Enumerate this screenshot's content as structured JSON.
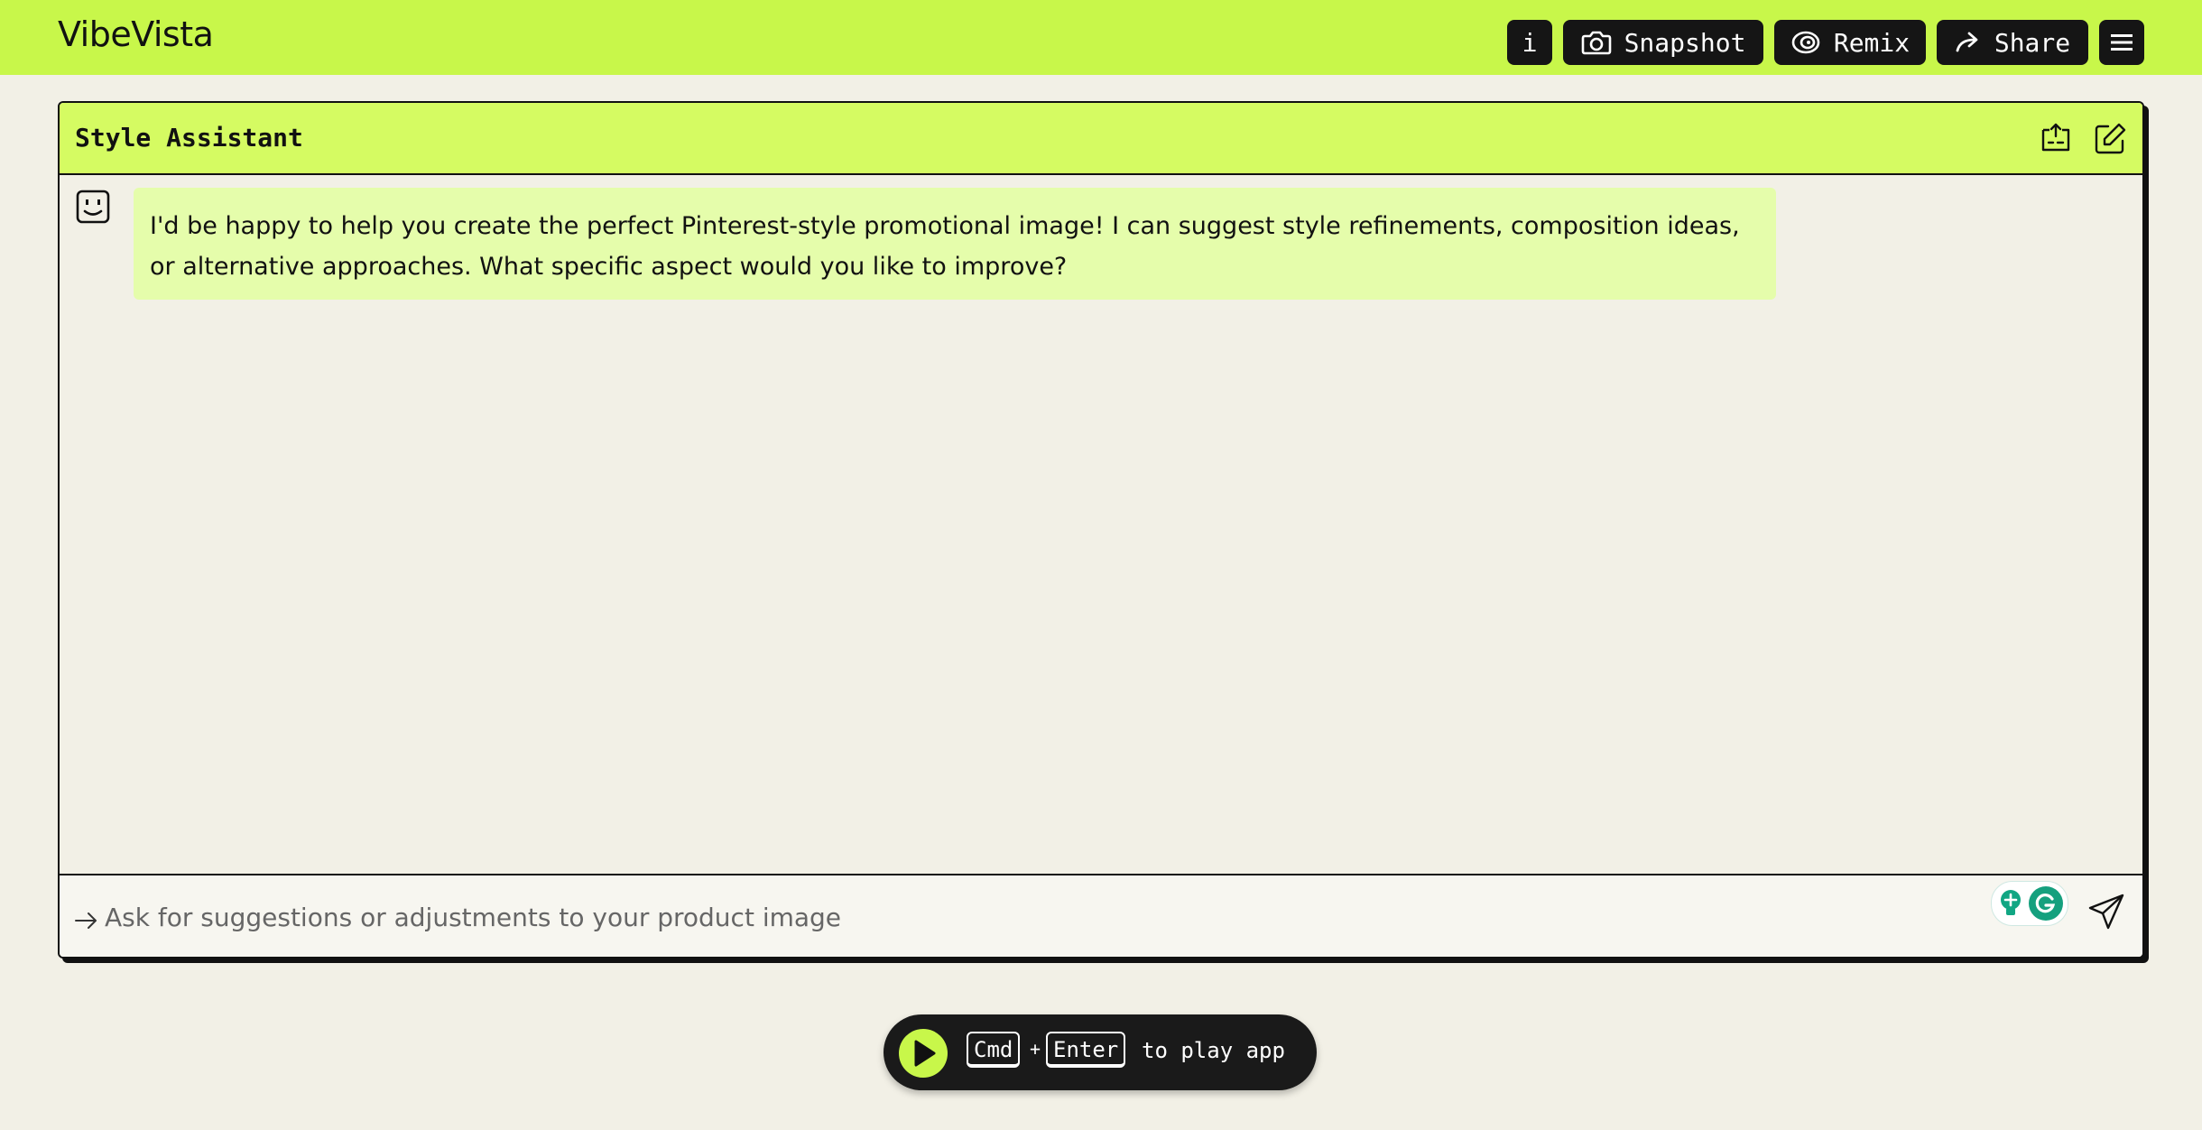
{
  "app": {
    "title": "VibeVista"
  },
  "toolbar": {
    "info_label": "i",
    "snapshot_label": "Snapshot",
    "remix_label": "Remix",
    "share_label": "Share",
    "icons": [
      "camera-icon",
      "remix-icon",
      "share-arrow-icon",
      "menu-icon"
    ]
  },
  "assistant": {
    "title": "Style Assistant",
    "header_icons": [
      "collapse-panel-icon",
      "edit-icon"
    ],
    "messages": [
      {
        "role": "assistant",
        "avatar_icon": "smiley-bot-icon",
        "text": "I'd be happy to help you create the perfect Pinterest-style promotional image! I can suggest style refinements, composition ideas, or alternative approaches. What specific aspect would you like to improve?"
      }
    ],
    "input": {
      "value": "",
      "placeholder": "Ask for suggestions or adjustments to your product image"
    }
  },
  "play_hint": {
    "key1": "Cmd",
    "plus": "+",
    "key2": "Enter",
    "text": "to play app"
  },
  "colors": {
    "accent": "#c8f74a",
    "header": "#d5fb62",
    "bubble": "#e5fdab",
    "background": "#f2f0e6",
    "dark": "#151515"
  }
}
